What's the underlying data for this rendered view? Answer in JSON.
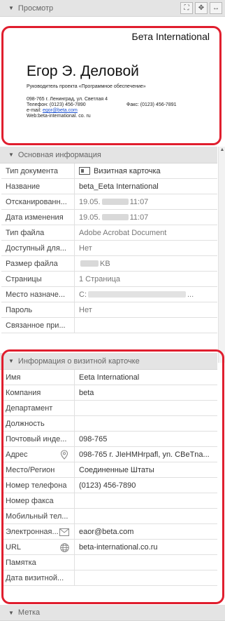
{
  "preview": {
    "header": "Просмотр",
    "card": {
      "company": "Бета International",
      "name": "Егор Э. Деловой",
      "title": "Руководитель проекта «Программное обеспечение»",
      "address": "098-765 г. Ленинград, ул. Светлая 4",
      "phone": "Телефон: (0123) 456-7890",
      "fax": "Факс: (0123) 456-7891",
      "email_prefix": "e-mail: ",
      "email": "egor@beta.com",
      "web": "Web:beta-international. co. ru"
    }
  },
  "basic_info": {
    "header": "Основная информация",
    "rows": [
      {
        "key": "Тип документа",
        "value": "Визитная карточка"
      },
      {
        "key": "Название",
        "value": "beta_Eeta International"
      },
      {
        "key": "Отсканированн...",
        "value_a": "19.05.",
        "value_b": "11:07"
      },
      {
        "key": "Дата изменения",
        "value_a": "19.05.",
        "value_b": "11:07"
      },
      {
        "key": "Тип файла",
        "value": "Adobe Acrobat Document"
      },
      {
        "key": "Доступный для...",
        "value": "Нет"
      },
      {
        "key": "Размер файла",
        "value": "KB"
      },
      {
        "key": "Страницы",
        "value": "1 Страница"
      },
      {
        "key": "Место назначе...",
        "value_a": "C:",
        "value_b": "..."
      },
      {
        "key": "Пароль",
        "value": "Нет"
      },
      {
        "key": "Связанное при...",
        "value": ""
      }
    ]
  },
  "card_info": {
    "header": "Информация о визитной карточке",
    "rows": [
      {
        "key": "Имя",
        "value": "Eeta International"
      },
      {
        "key": "Компания",
        "value": "beta"
      },
      {
        "key": "Департамент",
        "value": ""
      },
      {
        "key": "Должность",
        "value": ""
      },
      {
        "key": "Почтовый инде...",
        "value": "098-765"
      },
      {
        "key": "Адрес",
        "value": "098-765 г. JIeHMHrpafl, yn. CBeTna..."
      },
      {
        "key": "Место/Регион",
        "value": "Соединенные Штаты"
      },
      {
        "key": "Номер телефона",
        "value": "(0123) 456-7890"
      },
      {
        "key": "Номер факса",
        "value": ""
      },
      {
        "key": "Мобильный тел...",
        "value": ""
      },
      {
        "key": "Электронная...",
        "value": "eaor@beta.com"
      },
      {
        "key": "URL",
        "value": "beta-international.co.ru"
      },
      {
        "key": "Памятка",
        "value": ""
      },
      {
        "key": "Дата визитной...",
        "value": ""
      }
    ]
  },
  "label_section": {
    "header": "Метка"
  },
  "colors": {
    "highlight": "#e01e2e",
    "header_bg": "#e4e4e4",
    "link": "#1a4fd0"
  },
  "icons": [
    "fit-page-icon",
    "move-icon",
    "fit-width-icon",
    "location-pin-icon",
    "envelope-icon",
    "globe-icon"
  ]
}
